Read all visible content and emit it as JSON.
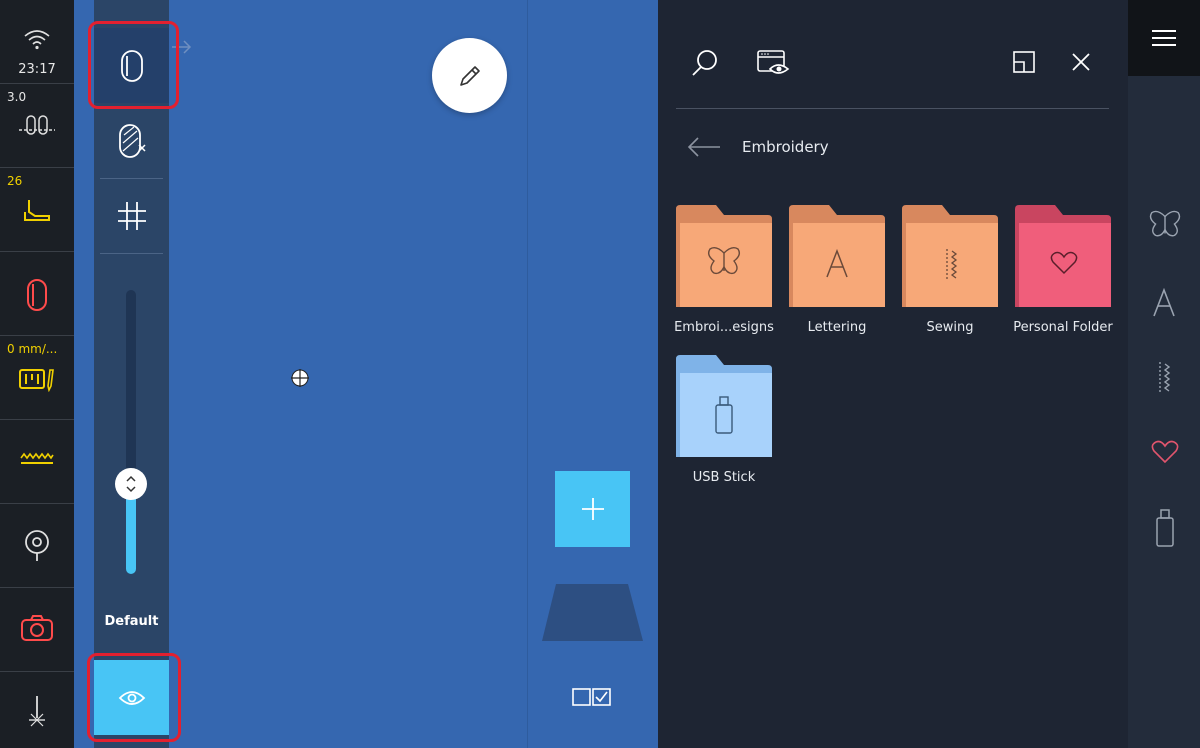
{
  "status": {
    "time": "23:17",
    "tension": "3.0",
    "presser_foot_value": "26",
    "speed_label": "0 mm/..."
  },
  "toolbar": {
    "slider_label": "Default"
  },
  "panel": {
    "breadcrumb": "Embroidery",
    "folders": [
      {
        "label": "Embroi...esigns",
        "icon": "butterfly-icon",
        "color": "#f7a878"
      },
      {
        "label": "Lettering",
        "icon": "letter-a-icon",
        "color": "#f7a878"
      },
      {
        "label": "Sewing",
        "icon": "stitch-icon",
        "color": "#f7a878"
      },
      {
        "label": "Personal Folder",
        "icon": "heart-icon",
        "color": "#f05e7b"
      },
      {
        "label": "USB Stick",
        "icon": "usb-icon",
        "color": "#a8d2fb"
      }
    ]
  },
  "colors": {
    "accent": "#48c5f5",
    "canvas": "#3567b0",
    "highlight": "#e3202f"
  }
}
